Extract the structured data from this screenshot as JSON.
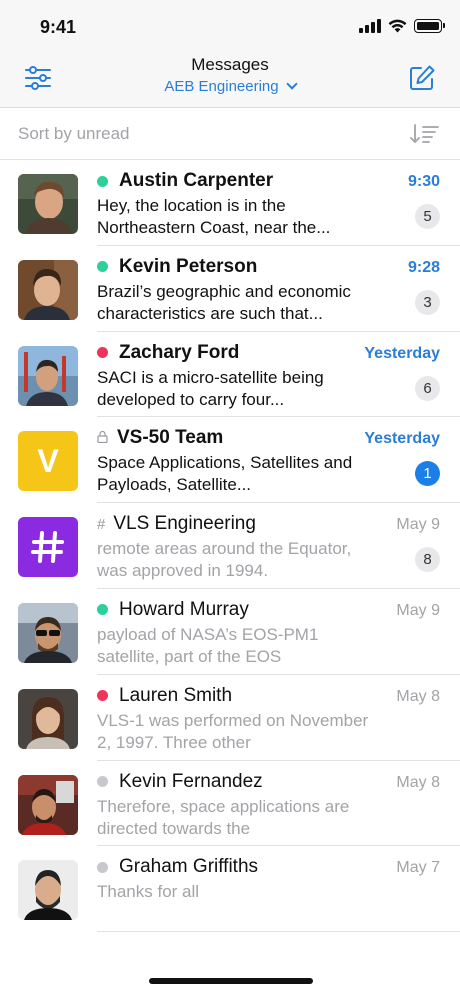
{
  "status_bar": {
    "time": "9:41"
  },
  "header": {
    "title": "Messages",
    "workspace": "AEB Engineering",
    "filter_icon": "sliders-icon",
    "compose_icon": "compose-icon"
  },
  "sort": {
    "label": "Sort by unread",
    "icon": "sort-descending-icon"
  },
  "colors": {
    "accent": "#2a7ed8",
    "online": "#2ecf9a",
    "busy": "#f0335a",
    "offline": "#c8c8cc",
    "channel_purple": "#8a2be2",
    "team_yellow": "#f5c518",
    "badge_blue": "#1c7fe8"
  },
  "conversations": [
    {
      "name": "Austin Carpenter",
      "time": "9:30",
      "preview": "Hey, the location is in the Northeastern Coast, near the...",
      "count": "5",
      "status": "online"
    },
    {
      "name": "Kevin Peterson",
      "time": "9:28",
      "preview": "Brazil’s geographic and economic characteristics are such that...",
      "count": "3",
      "status": "online"
    },
    {
      "name": "Zachary Ford",
      "time": "Yesterday",
      "preview": "SACI is a micro-satellite being developed to carry four...",
      "count": "6",
      "status": "busy"
    },
    {
      "name": "VS-50 Team",
      "time": "Yesterday",
      "preview": "Space Applications, Satellites and Payloads, Satellite...",
      "count": "1",
      "avatar_letter": "V",
      "type": "private-group"
    },
    {
      "name": "VLS Engineering",
      "time": "May 9",
      "preview": "remote areas around the Equator, was approved in 1994.",
      "count": "8",
      "type": "channel"
    },
    {
      "name": "Howard Murray",
      "time": "May 9",
      "preview": "payload of NASA’s EOS-PM1 satellite, part of the EOS",
      "status": "online"
    },
    {
      "name": "Lauren Smith",
      "time": "May 8",
      "preview": "VLS-1 was performed on November 2, 1997. Three other",
      "status": "busy"
    },
    {
      "name": "Kevin Fernandez",
      "time": "May 8",
      "preview": "Therefore, space applications are directed towards the",
      "status": "offline"
    },
    {
      "name": "Graham Griffiths",
      "time": "May 7",
      "preview": "Thanks for all",
      "status": "offline"
    }
  ]
}
